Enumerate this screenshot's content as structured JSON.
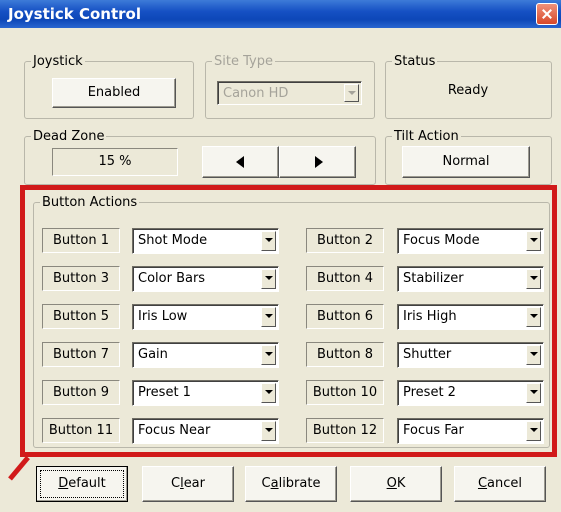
{
  "window": {
    "title": "Joystick Control"
  },
  "joystick": {
    "legend": "Joystick",
    "state": "Enabled"
  },
  "site_type": {
    "legend": "Site Type",
    "value": "Canon HD"
  },
  "status": {
    "legend": "Status",
    "value": "Ready"
  },
  "dead_zone": {
    "legend": "Dead Zone",
    "value": "15 %"
  },
  "tilt_action": {
    "legend": "Tilt Action",
    "value": "Normal"
  },
  "button_actions": {
    "legend": "Button Actions",
    "rows": [
      {
        "left": {
          "label": "Button 1",
          "action": "Shot Mode"
        },
        "right": {
          "label": "Button 2",
          "action": "Focus Mode"
        }
      },
      {
        "left": {
          "label": "Button 3",
          "action": "Color Bars"
        },
        "right": {
          "label": "Button 4",
          "action": "Stabilizer"
        }
      },
      {
        "left": {
          "label": "Button 5",
          "action": "Iris Low"
        },
        "right": {
          "label": "Button 6",
          "action": "Iris High"
        }
      },
      {
        "left": {
          "label": "Button 7",
          "action": "Gain"
        },
        "right": {
          "label": "Button 8",
          "action": "Shutter"
        }
      },
      {
        "left": {
          "label": "Button 9",
          "action": "Preset 1"
        },
        "right": {
          "label": "Button 10",
          "action": "Preset 2"
        }
      },
      {
        "left": {
          "label": "Button 11",
          "action": "Focus Near"
        },
        "right": {
          "label": "Button 12",
          "action": "Focus Far"
        }
      }
    ]
  },
  "footer": {
    "default": {
      "key": "D",
      "rest": "efault"
    },
    "clear": {
      "pre": "C",
      "key": "l",
      "rest": "ear"
    },
    "calibrate": {
      "pre": "C",
      "key": "a",
      "rest": "librate"
    },
    "ok": {
      "key": "O",
      "rest": "K"
    },
    "cancel": {
      "key": "C",
      "rest": "ancel"
    }
  },
  "colors": {
    "highlight": "#d11a1a",
    "titlebar": "#0d47b8"
  }
}
